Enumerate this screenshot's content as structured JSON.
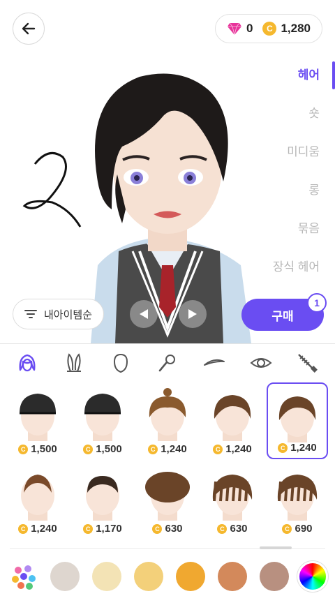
{
  "header": {
    "gems": "0",
    "coins": "1,280",
    "coin_symbol": "C"
  },
  "categories": [
    {
      "label": "헤어",
      "active": true
    },
    {
      "label": "숏",
      "active": false
    },
    {
      "label": "미디움",
      "active": false
    },
    {
      "label": "롱",
      "active": false
    },
    {
      "label": "묶음",
      "active": false
    },
    {
      "label": "장식 헤어",
      "active": false
    }
  ],
  "sort_button": {
    "label": "내아이템순"
  },
  "buy_button": {
    "label": "구매",
    "count": "1"
  },
  "tool_tabs": [
    "hair-icon",
    "bunny-ears-icon",
    "face-shape-icon",
    "microphone-icon",
    "eyebrow-icon",
    "eye-icon",
    "mascara-icon"
  ],
  "items": [
    {
      "price": "1,500",
      "hair_color": "#2b2b2b",
      "style": "beanie"
    },
    {
      "price": "1,500",
      "hair_color": "#2b2b2b",
      "style": "beanie"
    },
    {
      "price": "1,240",
      "hair_color": "#8a5a2e",
      "style": "bun"
    },
    {
      "price": "1,240",
      "hair_color": "#6a4428",
      "style": "fringe"
    },
    {
      "price": "1,240",
      "hair_color": "#6a4428",
      "style": "side",
      "selected": true
    },
    {
      "price": "1,240",
      "hair_color": "#7a4a2a",
      "style": "mohawk"
    },
    {
      "price": "1,170",
      "hair_color": "#3a2a20",
      "style": "short"
    },
    {
      "price": "630",
      "hair_color": "#6a4428",
      "style": "afro"
    },
    {
      "price": "630",
      "hair_color": "#6a4428",
      "style": "dreads"
    },
    {
      "price": "690",
      "hair_color": "#6a4428",
      "style": "dreads-long"
    }
  ],
  "swatches": [
    "#ded6cf",
    "#f3e3b5",
    "#f3d07a",
    "#f0a830",
    "#d3895b",
    "#b89080"
  ],
  "colors": {
    "accent": "#6a4df2"
  }
}
